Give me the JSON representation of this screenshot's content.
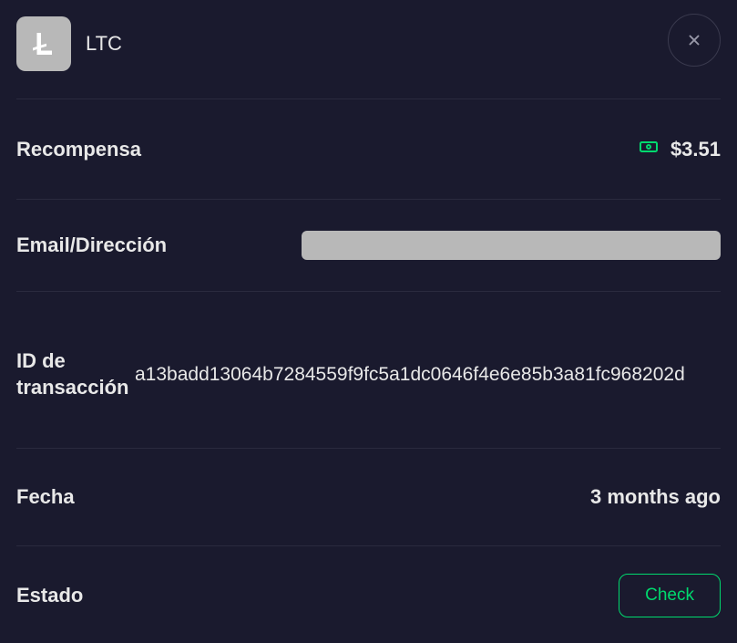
{
  "header": {
    "coin_symbol": "LTC"
  },
  "rows": {
    "reward": {
      "label": "Recompensa",
      "value": "$3.51"
    },
    "email": {
      "label": "Email/Dirección",
      "value": ""
    },
    "transaction": {
      "label": "ID de transacción",
      "id": "a13badd13064b7284559f9fc5a1dc0646f4e6e85b3a81fc968202d"
    },
    "date": {
      "label": "Fecha",
      "value": "3 months ago"
    },
    "status": {
      "label": "Estado",
      "button_label": "Check"
    }
  }
}
